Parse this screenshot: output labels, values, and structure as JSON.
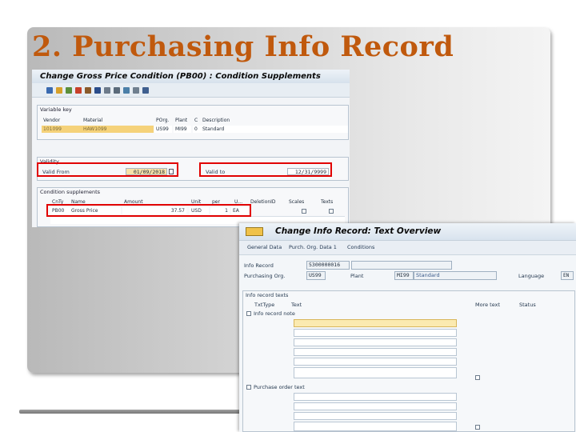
{
  "slide_title": "2. Purchasing Info Record",
  "screen1": {
    "title": "Change Gross Price Condition (PB00) : Condition Supplements",
    "variable_key": {
      "group_title": "Variable key",
      "headers": [
        "Vendor",
        "Material",
        "POrg.",
        "Plant",
        "C",
        "Description"
      ],
      "row": [
        "101099",
        "HAW1099",
        "US99",
        "MI99",
        "0",
        "Standard"
      ]
    },
    "validity": {
      "group_title": "Validity",
      "valid_from_label": "Valid From",
      "valid_from_value": "01/09/2018",
      "valid_to_label": "Valid to",
      "valid_to_value": "12/31/9999"
    },
    "conditions": {
      "group_title": "Condition supplements",
      "headers": [
        "CnTy",
        "Name",
        "Amount",
        "Unit",
        "per",
        "U...",
        "DeletionID",
        "Scales",
        "Texts"
      ],
      "row": [
        "PB00",
        "Gross Price",
        "37.57",
        "USD",
        "1",
        "EA"
      ]
    }
  },
  "screen2": {
    "title": "Change Info Record: Text Overview",
    "menu": [
      "General Data",
      "Purch. Org. Data 1",
      "Conditions"
    ],
    "info_record_label": "Info Record",
    "info_record_value": "5300000016",
    "purch_org_label": "Purchasing Org.",
    "purch_org_value": "US99",
    "plant_label": "Plant",
    "plant_value": "MI99",
    "plant_desc": "Standard",
    "language_label": "Language",
    "language_value": "EN",
    "texts_group_title": "Info record texts",
    "col_txttype": "TxtType",
    "col_text": "Text",
    "col_more": "More text",
    "col_status": "Status",
    "text_types": [
      "Info record note",
      "Purchase order text"
    ]
  },
  "colors": {
    "title": "#c0590d",
    "highlight": "#e10000"
  }
}
